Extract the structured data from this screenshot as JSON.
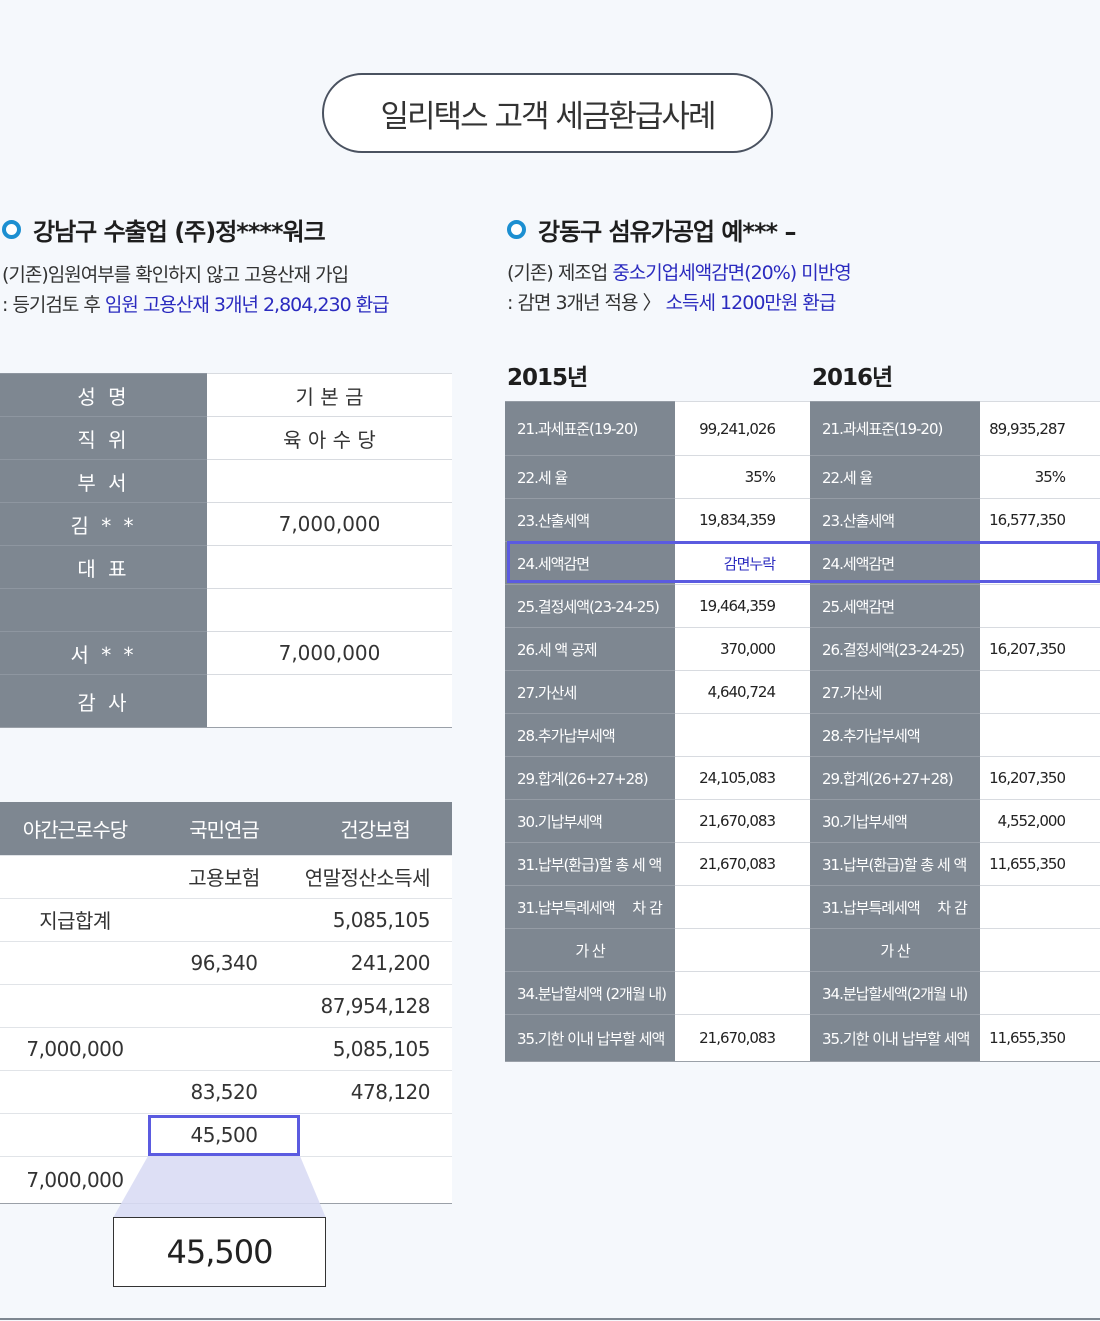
{
  "title": "일리택스 고객 세금환급사례",
  "left": {
    "heading": "강남구 수출업 (주)정****워크",
    "desc_line1": "(기존)임원여부를 확인하지 않고 고용산재 가입",
    "desc_line2_prefix": ": 등기검토 후 ",
    "desc_line2_highlight": "임원 고용산재 3개년 2,804,230 환급",
    "table1": [
      {
        "label": "성 명",
        "value": "기 본 금"
      },
      {
        "label": "직 위",
        "value": "육 아 수 당"
      },
      {
        "label": "부 서",
        "value": ""
      },
      {
        "label": "김 * *",
        "value": "7,000,000"
      },
      {
        "label": "대 표",
        "value": ""
      },
      {
        "label": "",
        "value": ""
      },
      {
        "label": "서 * *",
        "value": "7,000,000"
      },
      {
        "label": "감 사",
        "value": ""
      }
    ],
    "table2_headers": [
      "야간근로수당",
      "국민연금",
      "건강보험"
    ],
    "table2_rows": [
      [
        "",
        "고용보험",
        "연말정산소득세"
      ],
      [
        "지급합계",
        "",
        "5,085,105"
      ],
      [
        "",
        "96,340",
        "241,200"
      ],
      [
        "",
        "",
        "87,954,128"
      ],
      [
        "7,000,000",
        "",
        "5,085,105"
      ],
      [
        "",
        "83,520",
        "478,120"
      ],
      [
        "",
        "45,500",
        ""
      ],
      [
        "7,000,000",
        "",
        ""
      ]
    ],
    "zoom_value": "45,500"
  },
  "right": {
    "heading": "강동구 섬유가공업 예*** –",
    "desc_line1_prefix": "(기존) 제조업 ",
    "desc_line1_highlight": "중소기업세액감면(20%) 미반영",
    "desc_line2_prefix": ": 감면 3개년 적용 〉 ",
    "desc_line2_highlight": "소득세 1200만원 환급",
    "year1": "2015년",
    "year2": "2016년",
    "rows2015": [
      {
        "label": "21.과세표준(19-20)",
        "value": "99,241,026"
      },
      {
        "label": "22.세 율",
        "value": "35%"
      },
      {
        "label": "23.산출세액",
        "value": "19,834,359"
      },
      {
        "label": "24.세액감면",
        "value": "감면누락"
      },
      {
        "label": "25.결정세액(23-24-25)",
        "value": "19,464,359"
      },
      {
        "label": "26.세 액 공제",
        "value": "370,000"
      },
      {
        "label": "27.가산세",
        "value": "4,640,724"
      },
      {
        "label": "28.추가납부세액",
        "value": ""
      },
      {
        "label": "29.합계(26+27+28)",
        "value": "24,105,083"
      },
      {
        "label": "30.기납부세액",
        "value": "21,670,083"
      },
      {
        "label": "31.납부(환급)할 총 세 액",
        "value": "21,670,083"
      },
      {
        "label": "31.납부특례세액　 차 감",
        "value": ""
      },
      {
        "label": "가 산",
        "value": ""
      },
      {
        "label": "34.분납할세액 (2개월 내)",
        "value": ""
      },
      {
        "label": "35.기한 이내 납부할 세액",
        "value": "21,670,083"
      }
    ],
    "rows2016": [
      {
        "label": "21.과세표준(19-20)",
        "value": "89,935,287"
      },
      {
        "label": "22.세 율",
        "value": "35%"
      },
      {
        "label": "23.산출세액",
        "value": "16,577,350"
      },
      {
        "label": "24.세액감면",
        "value": ""
      },
      {
        "label": "25.세액감면",
        "value": ""
      },
      {
        "label": "26.결정세액(23-24-25)",
        "value": "16,207,350"
      },
      {
        "label": "27.가산세",
        "value": ""
      },
      {
        "label": "28.추가납부세액",
        "value": ""
      },
      {
        "label": "29.합계(26+27+28)",
        "value": "16,207,350"
      },
      {
        "label": "30.기납부세액",
        "value": "4,552,000"
      },
      {
        "label": "31.납부(환급)할 총 세 액",
        "value": "11,655,350"
      },
      {
        "label": "31.납부특례세액　 차 감",
        "value": ""
      },
      {
        "label": "가 산",
        "value": ""
      },
      {
        "label": "34.분납할세액(2개월 내)",
        "value": ""
      },
      {
        "label": "35.기한 이내 납부할 세액",
        "value": "11,655,350"
      }
    ]
  },
  "colors": {
    "accent_blue": "#2b2bbf",
    "ring": "#1c8fd1",
    "label_bg": "#7e8791",
    "highlight_box": "#5b5be0"
  }
}
